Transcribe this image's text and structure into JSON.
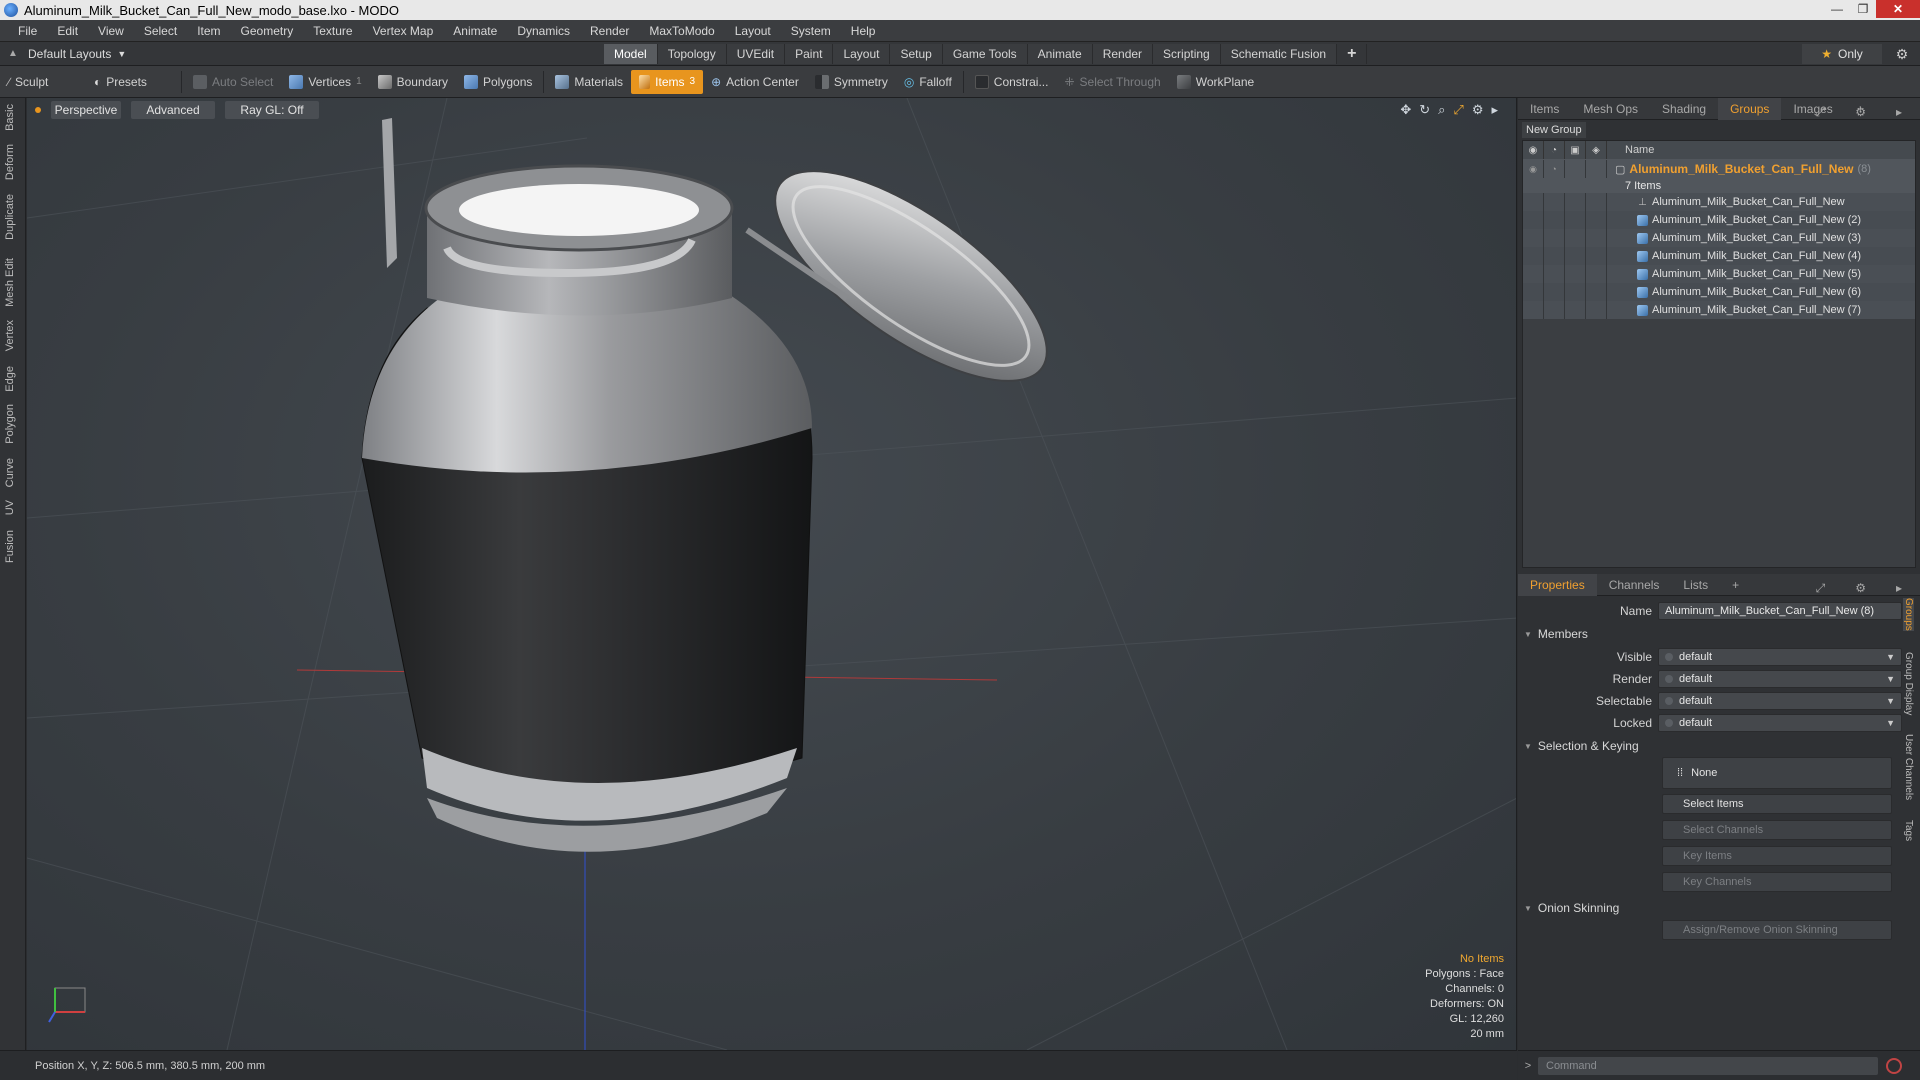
{
  "window": {
    "title": "Aluminum_Milk_Bucket_Can_Full_New_modo_base.lxo - MODO",
    "buttons": [
      "—",
      "❐",
      "✕"
    ]
  },
  "menu": [
    "File",
    "Edit",
    "View",
    "Select",
    "Item",
    "Geometry",
    "Texture",
    "Vertex Map",
    "Animate",
    "Dynamics",
    "Render",
    "MaxToModo",
    "Layout",
    "System",
    "Help"
  ],
  "layout_row": {
    "layout_name": "Default Layouts",
    "tabs": [
      "Model",
      "Topology",
      "UVEdit",
      "Paint",
      "Layout",
      "Setup",
      "Game Tools",
      "Animate",
      "Render",
      "Scripting",
      "Schematic Fusion"
    ],
    "active_tab": "Model",
    "plus": "+",
    "only_label": "Only"
  },
  "toolbar": {
    "sculpt": "Sculpt",
    "presets": "Presets",
    "auto_select": "Auto Select",
    "vertices": "Vertices",
    "vertices_count": "1",
    "boundary": "Boundary",
    "polygons": "Polygons",
    "materials": "Materials",
    "items": "Items",
    "items_count": "3",
    "action_center": "Action Center",
    "symmetry": "Symmetry",
    "falloff": "Falloff",
    "constraints": "Constrai...",
    "select_through": "Select Through",
    "workplane": "WorkPlane"
  },
  "left_tabs": [
    "Basic",
    "Deform",
    "Duplicate",
    "Mesh Edit",
    "Vertex",
    "Edge",
    "Polygon",
    "Curve",
    "UV",
    "Fusion"
  ],
  "viewport": {
    "view_mode": "Perspective",
    "advanced": "Advanced",
    "raygl": "Ray GL: Off",
    "info": {
      "selection": "No Items",
      "polygons": "Polygons : Face",
      "channels": "Channels: 0",
      "deformers": "Deformers: ON",
      "gl": "GL: 12,260",
      "scale": "20 mm"
    },
    "colors": {
      "accent": "#f0a830",
      "axis_x": "#d04040",
      "axis_y": "#40c040",
      "axis_z": "#4060e0"
    }
  },
  "status": {
    "position": "Position X, Y, Z:   506.5 mm, 380.5 mm, 200 mm"
  },
  "groups_panel": {
    "tabs": [
      "Items",
      "Mesh Ops",
      "Shading",
      "Groups",
      "Images",
      "+"
    ],
    "active_tab": "Groups",
    "new_group": "New Group",
    "name_header": "Name",
    "group": {
      "name": "Aluminum_Milk_Bucket_Can_Full_New",
      "count_suffix": "(8)",
      "sub": "7 Items"
    },
    "items": [
      {
        "name": "Aluminum_Milk_Bucket_Can_Full_New",
        "icon": "locator-icon"
      },
      {
        "name": "Aluminum_Milk_Bucket_Can_Full_New (2)",
        "icon": "mesh-icon"
      },
      {
        "name": "Aluminum_Milk_Bucket_Can_Full_New (3)",
        "icon": "mesh-icon"
      },
      {
        "name": "Aluminum_Milk_Bucket_Can_Full_New (4)",
        "icon": "mesh-icon"
      },
      {
        "name": "Aluminum_Milk_Bucket_Can_Full_New (5)",
        "icon": "mesh-icon"
      },
      {
        "name": "Aluminum_Milk_Bucket_Can_Full_New (6)",
        "icon": "mesh-icon"
      },
      {
        "name": "Aluminum_Milk_Bucket_Can_Full_New (7)",
        "icon": "mesh-icon"
      }
    ]
  },
  "properties_panel": {
    "tabs": [
      "Properties",
      "Channels",
      "Lists",
      "+"
    ],
    "active_tab": "Properties",
    "name_label": "Name",
    "name_value": "Aluminum_Milk_Bucket_Can_Full_New (8)",
    "members_section": "Members",
    "visible_label": "Visible",
    "visible_value": "default",
    "render_label": "Render",
    "render_value": "default",
    "selectable_label": "Selectable",
    "selectable_value": "default",
    "locked_label": "Locked",
    "locked_value": "default",
    "selection_section": "Selection & Keying",
    "none_btn": "None",
    "select_items": "Select Items",
    "select_channels": "Select Channels",
    "key_items": "Key Items",
    "key_channels": "Key Channels",
    "onion_section": "Onion Skinning",
    "onion_btn": "Assign/Remove Onion Skinning",
    "side_tabs": [
      "Groups",
      "Group Display",
      "User Channels",
      "Tags"
    ]
  },
  "command": {
    "placeholder": "Command"
  }
}
